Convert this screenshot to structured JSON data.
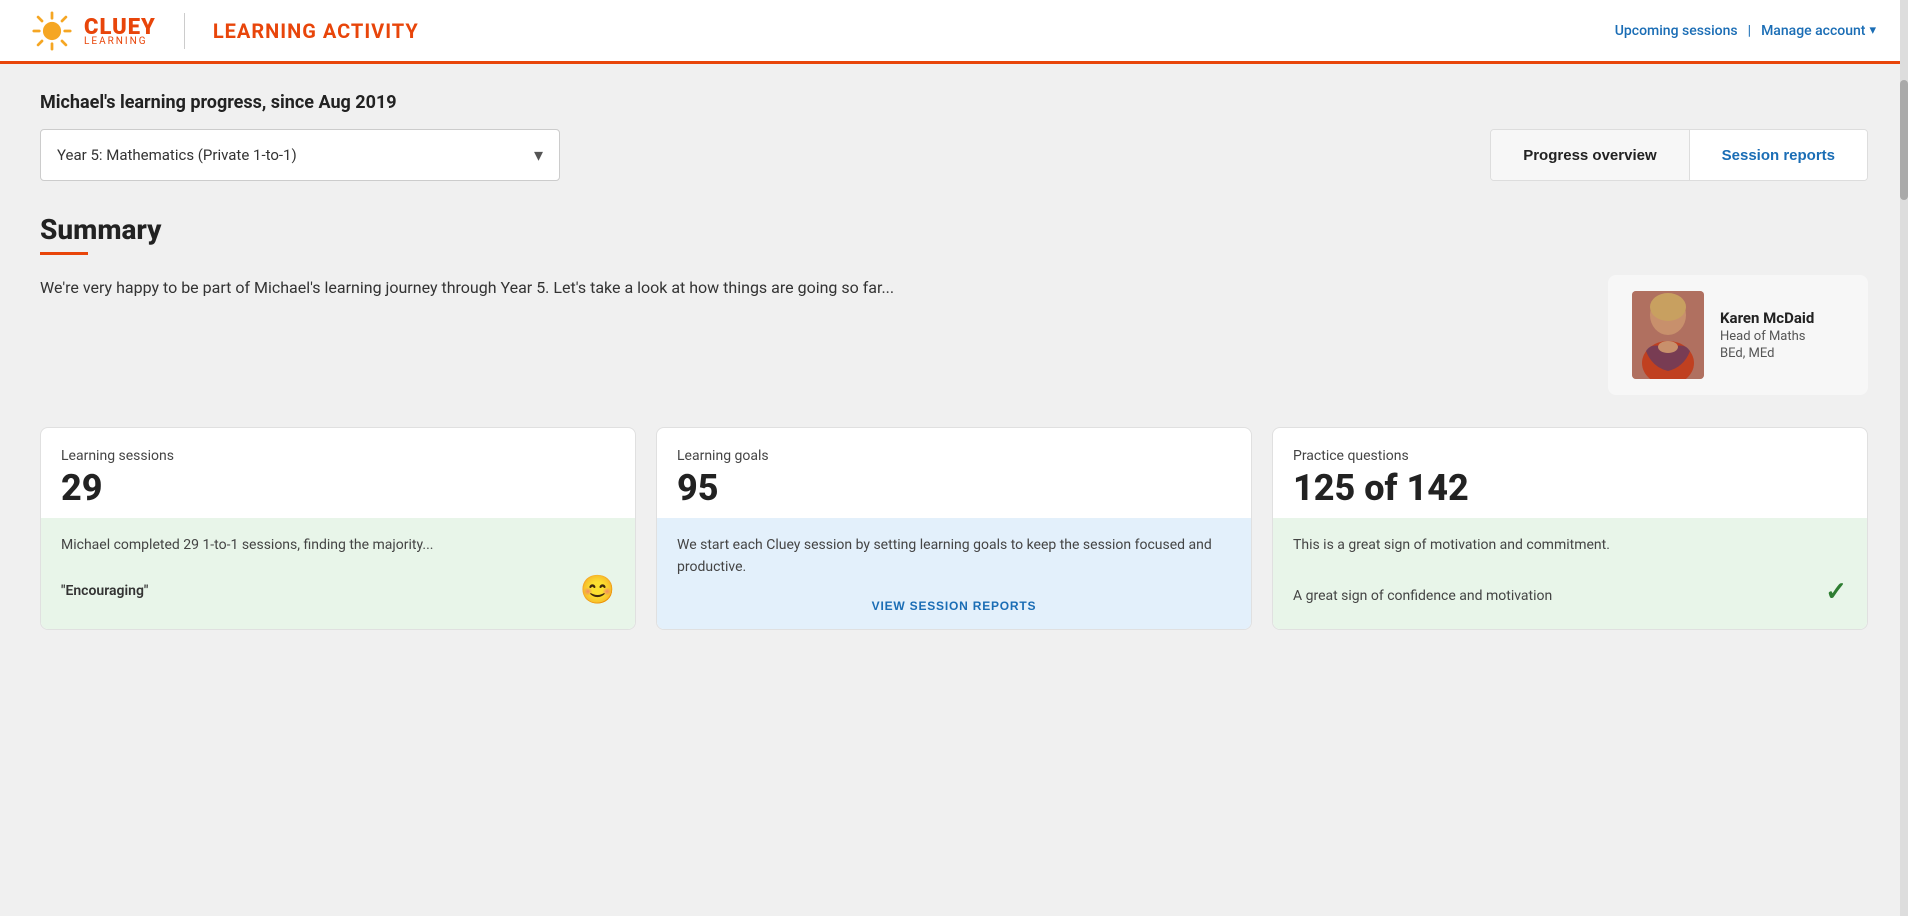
{
  "header": {
    "logo_cluey": "CLUEY",
    "logo_sub": "LEARNING",
    "title": "LEARNING ACTIVITY",
    "nav": {
      "upcoming_sessions": "Upcoming sessions",
      "separator": "|",
      "manage_account": "Manage account",
      "manage_chevron": "▾"
    }
  },
  "page": {
    "heading": "Michael's learning progress, since Aug 2019"
  },
  "subject_select": {
    "value": "Year 5: Mathematics (Private 1-to-1)",
    "placeholder": "Year 5: Mathematics (Private 1-to-1)"
  },
  "tabs": [
    {
      "id": "progress-overview",
      "label": "Progress overview",
      "active": true
    },
    {
      "id": "session-reports",
      "label": "Session reports",
      "active": false
    }
  ],
  "summary": {
    "title": "Summary",
    "text": "We're very happy to be part of Michael's learning journey through Year 5. Let's take a look at how things are going so far...",
    "tutor": {
      "name": "Karen McDaid",
      "role": "Head of Maths",
      "credentials": "BEd, MEd"
    }
  },
  "cards": [
    {
      "id": "learning-sessions",
      "label": "Learning sessions",
      "number": "29",
      "description": "Michael completed 29 1-to-1 sessions, finding the majority...",
      "badge": "\"Encouraging\"",
      "emoji": "😊",
      "bg": "green"
    },
    {
      "id": "learning-goals",
      "label": "Learning goals",
      "number": "95",
      "description": "We start each Cluey session by setting learning goals to keep the session focused and productive.",
      "link": "VIEW SESSION REPORTS",
      "bg": "blue"
    },
    {
      "id": "practice-questions",
      "label": "Practice questions",
      "number": "125 of 142",
      "description": "This is a great sign of motivation and commitment.",
      "confidence": "A great sign of confidence and motivation",
      "bg": "green"
    }
  ]
}
